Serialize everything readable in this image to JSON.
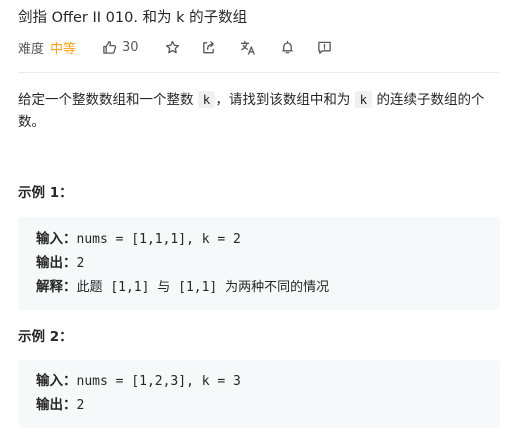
{
  "problem": {
    "title": "剑指 Offer II 010. 和为 k 的子数组",
    "difficulty_label": "难度",
    "difficulty": "中等",
    "likes": "30"
  },
  "description": {
    "part1": "给定一个整数数组和一个整数 ",
    "code1": "k",
    "part2": "，请找到该数组中和为 ",
    "code2": "k",
    "part3": " 的连续子数组的个数。"
  },
  "examples": [
    {
      "title": "示例 1：",
      "input_label": "输入：",
      "input": "nums = [1,1,1], k = 2",
      "output_label": "输出：",
      "output": "2",
      "explain_label": "解释：",
      "explain": "此题 [1,1] 与 [1,1] 为两种不同的情况"
    },
    {
      "title": "示例 2：",
      "input_label": "输入：",
      "input": "nums = [1,2,3], k = 3",
      "output_label": "输出：",
      "output": "2"
    }
  ],
  "colors": {
    "difficulty_medium": "#ffa116",
    "text": "#262626",
    "muted": "#595959",
    "example_bg": "#f7f8fa"
  },
  "icons": [
    "thumbs-up-icon",
    "star-icon",
    "share-icon",
    "translate-icon",
    "bell-icon",
    "feedback-icon"
  ]
}
